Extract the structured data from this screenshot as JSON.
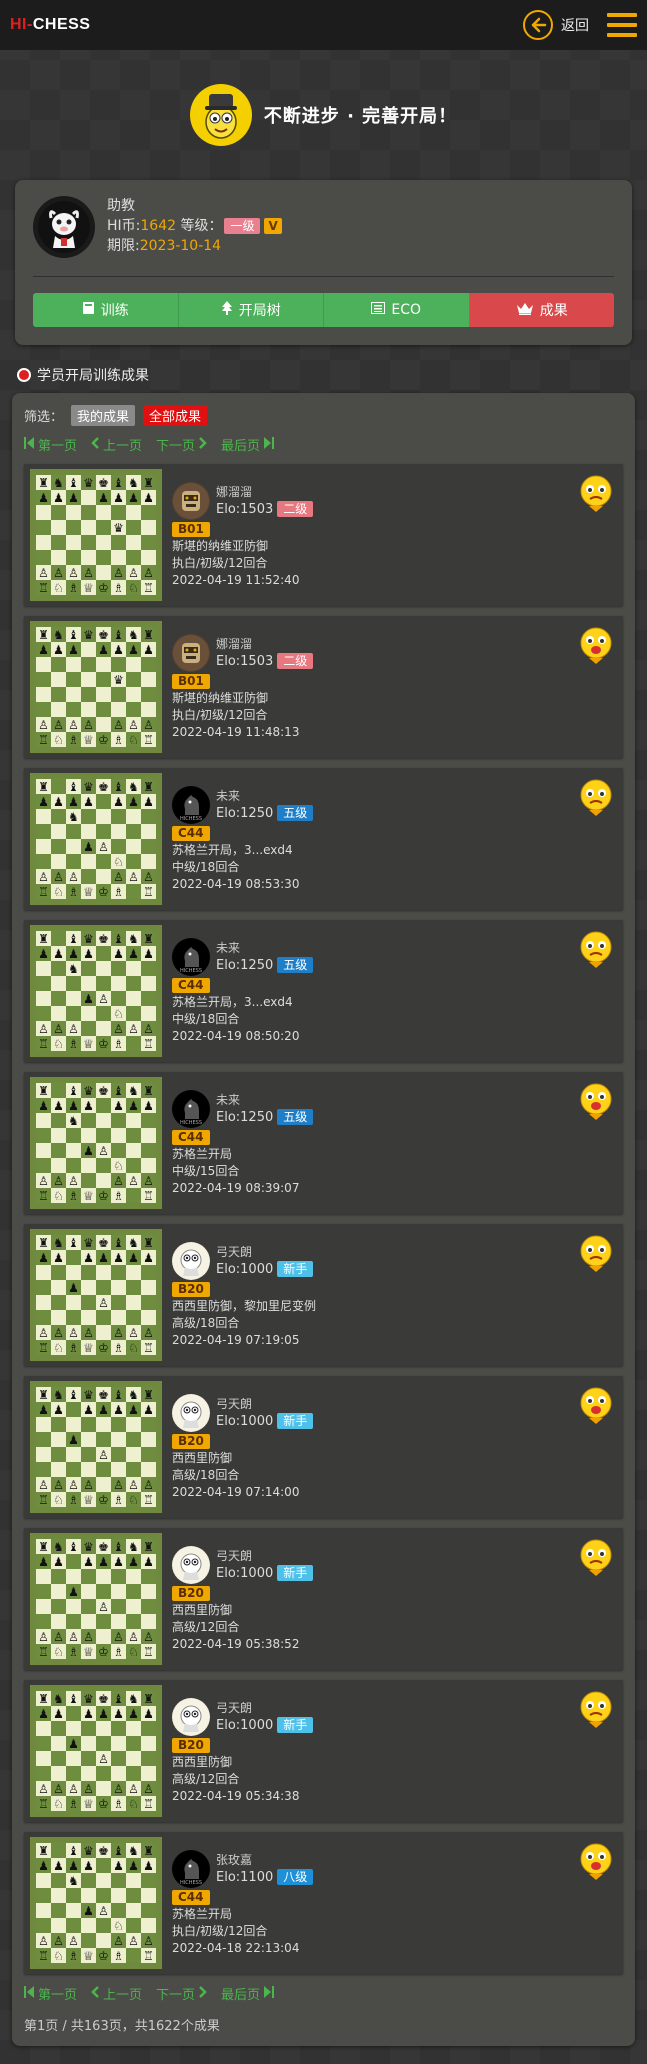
{
  "header": {
    "logo_hi": "HI",
    "logo_dash": "-",
    "logo_chess": "CHESS",
    "back_label": "返回",
    "accent": "#f0a800"
  },
  "hero": {
    "slogan": "不断进步 · 完善开局！"
  },
  "profile": {
    "name": "助教",
    "coins_label": "HI币:",
    "coins": "1642",
    "level_label": "等级：",
    "level": "一级",
    "vip": "V",
    "expiry_label": "期限:",
    "expiry": "2023-10-14"
  },
  "tabs": [
    {
      "label": "训练",
      "icon": "book-icon"
    },
    {
      "label": "开局树",
      "icon": "tree-icon"
    },
    {
      "label": "ECO",
      "icon": "list-icon"
    },
    {
      "label": "成果",
      "icon": "crown-icon"
    }
  ],
  "section": {
    "title": "学员开局训练成果"
  },
  "filter": {
    "label": "筛选：",
    "mine": "我的成果",
    "all": "全部成果"
  },
  "pager": {
    "first": "第一页",
    "prev": "上一页",
    "next": "下一页",
    "last": "最后页"
  },
  "games": [
    {
      "name": "娜溜溜",
      "elo": "Elo:1503",
      "grade": "二级",
      "grade_color": "#e87880",
      "eco": "B01",
      "opening": "斯堪的纳维亚防御",
      "detail": "执白/初级/12回合",
      "time": "2022-04-19 11:52:40",
      "avatar": "robot",
      "emoji": "sad",
      "board": "b1"
    },
    {
      "name": "娜溜溜",
      "elo": "Elo:1503",
      "grade": "二级",
      "grade_color": "#e87880",
      "eco": "B01",
      "opening": "斯堪的纳维亚防御",
      "detail": "执白/初级/12回合",
      "time": "2022-04-19 11:48:13",
      "avatar": "robot",
      "emoji": "happy",
      "board": "b1"
    },
    {
      "name": "未来",
      "elo": "Elo:1250",
      "grade": "五级",
      "grade_color": "#1e7fc8",
      "eco": "C44",
      "opening": "苏格兰开局，3...exd4",
      "detail": "中级/18回合",
      "time": "2022-04-19 08:53:30",
      "avatar": "knight",
      "emoji": "sad",
      "board": "b2"
    },
    {
      "name": "未来",
      "elo": "Elo:1250",
      "grade": "五级",
      "grade_color": "#1e7fc8",
      "eco": "C44",
      "opening": "苏格兰开局，3...exd4",
      "detail": "中级/18回合",
      "time": "2022-04-19 08:50:20",
      "avatar": "knight",
      "emoji": "sad",
      "board": "b2"
    },
    {
      "name": "未来",
      "elo": "Elo:1250",
      "grade": "五级",
      "grade_color": "#1e7fc8",
      "eco": "C44",
      "opening": "苏格兰开局",
      "detail": "中级/15回合",
      "time": "2022-04-19 08:39:07",
      "avatar": "knight",
      "emoji": "happy",
      "board": "b2"
    },
    {
      "name": "弓天朗",
      "elo": "Elo:1000",
      "grade": "新手",
      "grade_color": "#4fc0e8",
      "eco": "B20",
      "opening": "西西里防御，黎加里尼变例",
      "detail": "高级/18回合",
      "time": "2022-04-19 07:19:05",
      "avatar": "pawn",
      "emoji": "sad",
      "board": "b3"
    },
    {
      "name": "弓天朗",
      "elo": "Elo:1000",
      "grade": "新手",
      "grade_color": "#4fc0e8",
      "eco": "B20",
      "opening": "西西里防御",
      "detail": "高级/18回合",
      "time": "2022-04-19 07:14:00",
      "avatar": "pawn",
      "emoji": "happy",
      "board": "b3"
    },
    {
      "name": "弓天朗",
      "elo": "Elo:1000",
      "grade": "新手",
      "grade_color": "#4fc0e8",
      "eco": "B20",
      "opening": "西西里防御",
      "detail": "高级/12回合",
      "time": "2022-04-19 05:38:52",
      "avatar": "pawn",
      "emoji": "sad",
      "board": "b3"
    },
    {
      "name": "弓天朗",
      "elo": "Elo:1000",
      "grade": "新手",
      "grade_color": "#4fc0e8",
      "eco": "B20",
      "opening": "西西里防御",
      "detail": "高级/12回合",
      "time": "2022-04-19 05:34:38",
      "avatar": "pawn",
      "emoji": "sad",
      "board": "b3"
    },
    {
      "name": "张玫嘉",
      "elo": "Elo:1100",
      "grade": "八级",
      "grade_color": "#1e90d8",
      "eco": "C44",
      "opening": "苏格兰开局",
      "detail": "执白/初级/12回合",
      "time": "2022-04-18 22:13:04",
      "avatar": "knight",
      "emoji": "happy",
      "board": "b2"
    }
  ],
  "footer": {
    "summary": "第1页 / 共163页，共1622个成果"
  }
}
